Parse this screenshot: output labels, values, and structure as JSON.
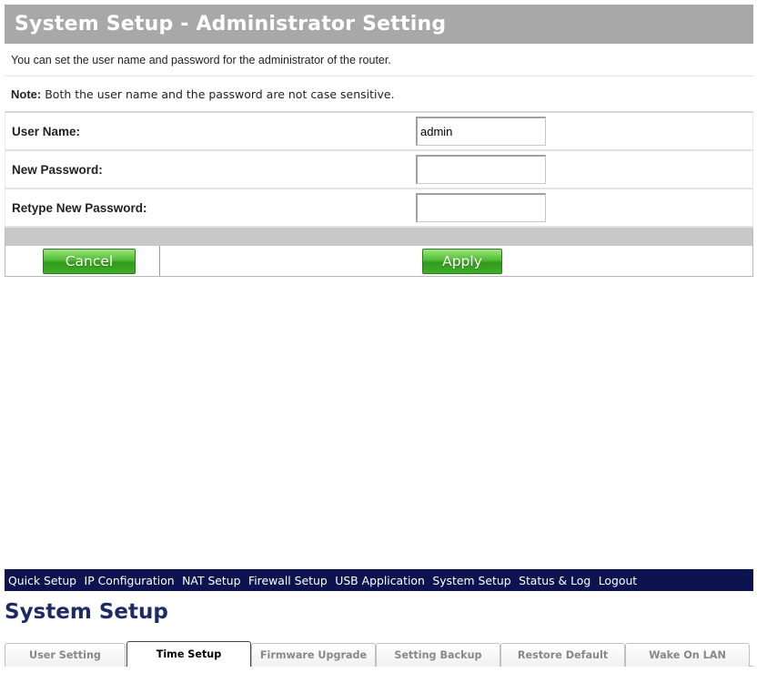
{
  "admin": {
    "title": "System Setup - Administrator Setting",
    "description": "You can set the user name and password for the administrator of the router.",
    "note_label": "Note:",
    "note_text": "Both the user name and the password are not case sensitive.",
    "fields": [
      {
        "label": "User Name:",
        "value": "admin"
      },
      {
        "label": "New Password:",
        "value": ""
      },
      {
        "label": "Retype New Password:",
        "value": ""
      }
    ],
    "cancel_label": "Cancel",
    "apply_label": "Apply"
  },
  "nav": {
    "items": [
      "Quick Setup",
      "IP Configuration",
      "NAT Setup",
      "Firewall Setup",
      "USB Application",
      "System Setup",
      "Status & Log",
      "Logout"
    ]
  },
  "section": {
    "title": "System Setup"
  },
  "tabs": {
    "items": [
      "User Setting",
      "Time Setup",
      "Firmware Upgrade",
      "Setting Backup",
      "Restore Default",
      "Wake On LAN"
    ],
    "active": "Time Setup"
  },
  "colors": {
    "header_bg": "#a8a8a8",
    "nav_bg": "#0d1350",
    "button_green": "#3fae27"
  }
}
